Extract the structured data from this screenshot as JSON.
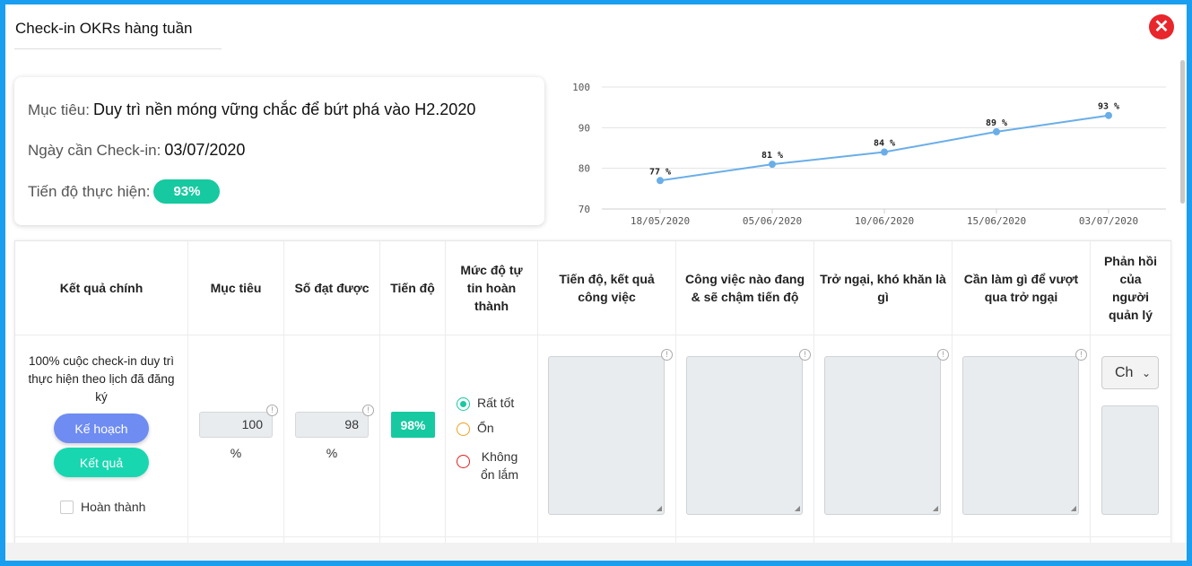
{
  "modal": {
    "title": "Check-in OKRs hàng tuần",
    "close_icon": "close-icon",
    "close_color": "#e8262b"
  },
  "info": {
    "objective_label": "Mục tiêu:",
    "objective_value": "Duy trì nền móng vững chắc để bứt phá vào H2.2020",
    "date_label": "Ngày cần Check-in:",
    "date_value": "03/07/2020",
    "progress_label": "Tiến độ thực hiện:",
    "progress_value": "93%"
  },
  "chart_data": {
    "type": "line",
    "x": [
      "18/05/2020",
      "05/06/2020",
      "10/06/2020",
      "15/06/2020",
      "03/07/2020"
    ],
    "values": [
      77,
      81,
      84,
      89,
      93
    ],
    "data_labels": [
      "77 %",
      "81 %",
      "84 %",
      "89 %",
      "93 %"
    ],
    "yticks": [
      "100",
      "90",
      "80",
      "70"
    ],
    "ylim": [
      70,
      100
    ],
    "grid": true,
    "line_color": "#6aaee8"
  },
  "table": {
    "headers": [
      "Kết quả chính",
      "Mục tiêu",
      "Số đạt được",
      "Tiến độ",
      "Mức độ tự tin hoàn thành",
      "Tiến độ, kết quả công việc",
      "Công việc nào đang & sẽ chậm tiến độ",
      "Trở ngại, khó khăn là gì",
      "Cần làm gì để vượt qua trở ngại",
      "Phản hồi của người quản lý"
    ],
    "row": {
      "key_result": "100% cuộc check-in duy trì thực hiện theo lịch đã đăng ký",
      "plan_button": "Kế hoạch",
      "result_button": "Kết quả",
      "done_label": "Hoàn thành",
      "target_value": "100",
      "target_unit": "%",
      "achieved_value": "98",
      "achieved_unit": "%",
      "progress": "98%",
      "confidence_options": [
        "Rất tốt",
        "Ổn",
        "Không ổn lắm"
      ],
      "confidence_selected": "Rất tốt",
      "manager_select": "Ch"
    }
  }
}
